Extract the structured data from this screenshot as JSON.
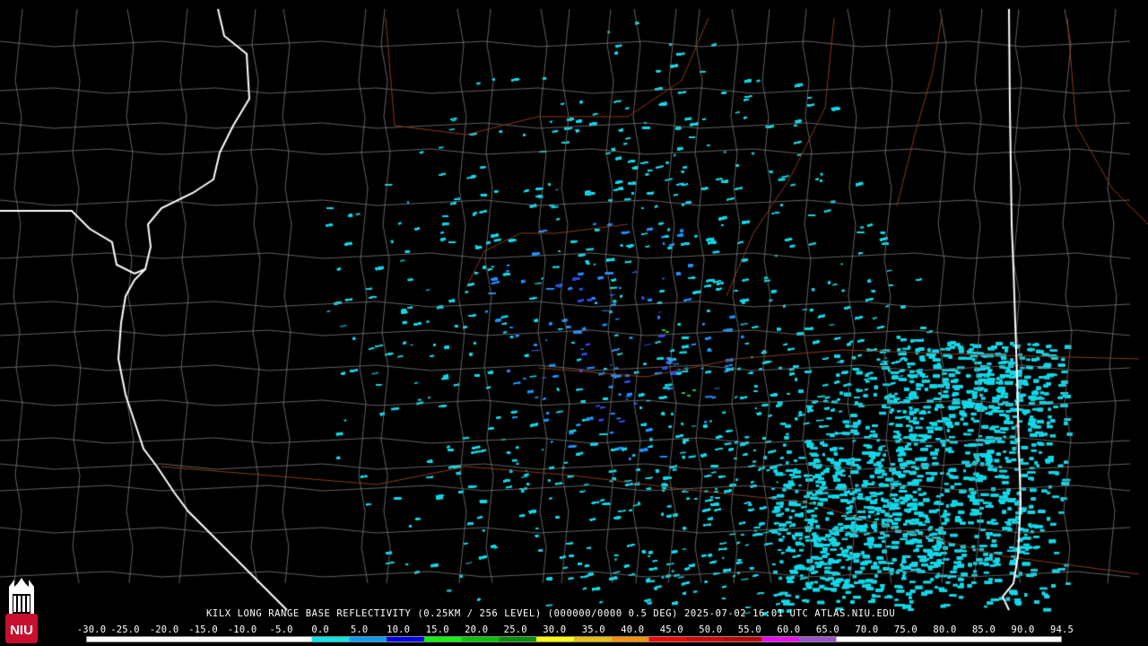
{
  "product_title": "KILX LONG RANGE BASE REFLECTIVITY (0.25KM / 256 LEVEL) (000000/0000 0.5 DEG) 2025-07-02 16:01 UTC  ATLAS.NIU.EDU",
  "logo_text": "NIU",
  "scale": {
    "labels": [
      "-30.0",
      "-25.0",
      "-20.0",
      "-15.0",
      "-10.0",
      "-5.0",
      "0.0",
      "5.0",
      "10.0",
      "15.0",
      "20.0",
      "25.0",
      "30.0",
      "35.0",
      "40.0",
      "45.0",
      "50.0",
      "55.0",
      "60.0",
      "65.0",
      "70.0",
      "75.0",
      "80.0",
      "85.0",
      "90.0",
      "94.5"
    ],
    "colors": [
      "#ffffff",
      "#ffffff",
      "#ffffff",
      "#ffffff",
      "#ffffff",
      "#ffffff",
      "#00e8e8",
      "#00a0f6",
      "#0000f6",
      "#00ff00",
      "#00c800",
      "#009000",
      "#ffff00",
      "#e7c000",
      "#ff9000",
      "#ff0000",
      "#d60000",
      "#c00000",
      "#ff00ff",
      "#9955c9",
      "#ffffff",
      "#ffffff",
      "#ffffff",
      "#ffffff",
      "#ffffff",
      "#ffffff"
    ]
  },
  "colors": {
    "background": "#000000",
    "county_lines": "#7a7a7a",
    "state_lines": "#ffffff",
    "highways": "#8b3a1a",
    "echo_light": "#10d8e8",
    "echo_medium": "#1e90ff",
    "echo_strong": "#2c4ae8",
    "echo_green": "#28c030"
  }
}
